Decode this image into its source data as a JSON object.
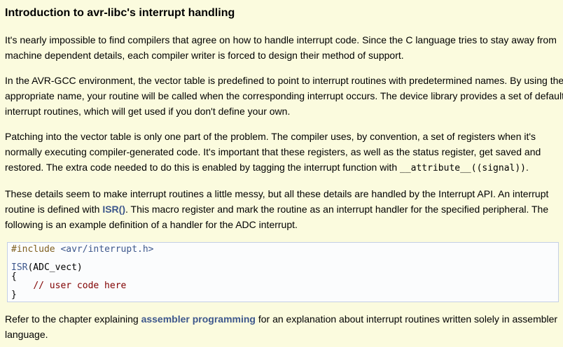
{
  "title": "Introduction to avr-libc's interrupt handling",
  "p1": [
    "It's nearly impossible to find compilers that agree on how to handle interrupt code. Since the C language tries to stay away from",
    "machine dependent details, each compiler writer is forced to design their method of support."
  ],
  "p2": [
    "In the AVR-GCC environment, the vector table is predefined to point to interrupt routines with predetermined names. By using the",
    "appropriate name, your routine will be called when the corresponding interrupt occurs. The device library provides a set of default",
    "interrupt routines, which will get used if you don't define your own."
  ],
  "p3": {
    "line1": "Patching into the vector table is only one part of the problem. The compiler uses, by convention, a set of registers when it's",
    "line2": "normally executing compiler-generated code. It's important that these registers, as well as the status register, get saved and",
    "line3_pre": "restored. The extra code needed to do this is enabled by tagging the interrupt function with ",
    "line3_code": "__attribute__((signal))",
    "line3_post": "."
  },
  "p4": {
    "line1": "These details seem to make interrupt routines a little messy, but all these details are handled by the Interrupt API. An interrupt",
    "line2_pre": "routine is defined with ",
    "line2_link": "ISR()",
    "line2_post": ". This macro register and mark the routine as an interrupt handler for the specified peripheral. The",
    "line3": "following is an example definition of a handler for the ADC interrupt."
  },
  "code": {
    "include_directive": "#include ",
    "include_file": "<avr/interrupt.h>",
    "isr_name": "ISR",
    "isr_args": "(ADC_vect)",
    "open_brace": "{",
    "indent": "    ",
    "comment": "// user code here",
    "close_brace": "}"
  },
  "p5": {
    "line1_pre": "Refer to the chapter explaining ",
    "line1_link": "assembler programming",
    "line1_post": " for an explanation about interrupt routines written solely in assembler",
    "line2": "language."
  },
  "colors": {
    "background": "#FBFBDE",
    "link": "#3D578C",
    "code_background": "#FBFCFD",
    "code_border": "#C4CFE5",
    "preprocessor": "#806020",
    "comment": "#800000"
  }
}
